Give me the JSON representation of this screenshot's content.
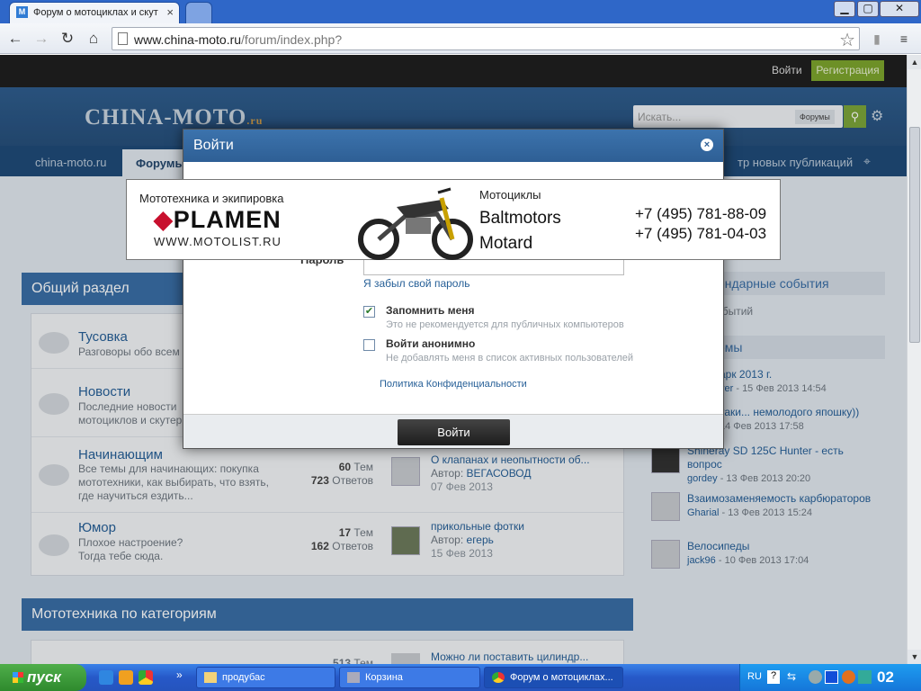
{
  "browser": {
    "tab_title": "Форум о мотоциклах и скут",
    "url_host": "www.china-moto.ru",
    "url_path": "/forum/index.php?",
    "win_min": "▁",
    "win_max": "▢",
    "win_close": "✕",
    "tab_close": "×"
  },
  "site": {
    "login": "Войти",
    "register": "Регистрация",
    "logo": "CHINA-MOTO",
    "logo_suffix": ".ru",
    "search_placeholder": "Искать...",
    "search_scope": "Форумы",
    "nav": {
      "home": "china-moto.ru",
      "forums": "Форумы",
      "new_posts": "тр новых публикаций"
    }
  },
  "forums": {
    "section_title": "Общий раздел",
    "rows": [
      {
        "title": "Тусовка",
        "desc": "Разговоры обо всем"
      },
      {
        "title": "Новости",
        "desc": "Последние новости\nмотоциклов и скутер"
      },
      {
        "title": "Начинающим",
        "desc": "Все темы для начинающих: покупка мототехники, как выбирать, что взять, где научиться ездить...",
        "threads": "60",
        "threads_label": "Тем",
        "posts": "723",
        "posts_label": "Ответов",
        "last_title": "О клапанах и неопытности об...",
        "last_by_label": "Автор:",
        "last_by": "ВЕГАСОВОД",
        "last_date": "07 Фев 2013"
      },
      {
        "title": "Юмор",
        "desc": "Плохое настроение?\nТогда тебе сюда.",
        "threads": "17",
        "threads_label": "Тем",
        "posts": "162",
        "posts_label": "Ответов",
        "last_title": "прикольные фотки",
        "last_by_label": "Автор:",
        "last_by": "егерь",
        "last_date": "15 Фев 2013"
      }
    ],
    "section2_title": "Мототехника по категориям",
    "next_row": {
      "threads": "513",
      "threads_label": "Тем",
      "last_title": "Можно ли поставить цилиндр..."
    }
  },
  "sidebar": {
    "calendar_title": "ендарные события",
    "calendar_text": "щих событий",
    "topics_title": "емы",
    "topics": [
      {
        "title": "арк 2013 г.",
        "user": "ver",
        "date": "- 15 Фев 2013 14:54"
      },
      {
        "title": "таки... немолодого япошку))",
        "user": "",
        "date": "14 Фев 2013 17:58"
      },
      {
        "title": "Shineray SD 125C Hunter - есть вопрос",
        "user": "gordey",
        "date": "- 13 Фев 2013 20:20"
      },
      {
        "title": "Взаимозаменяемость карбюраторов",
        "user": "Gharial",
        "date": "- 13 Фев 2013 15:24"
      },
      {
        "title": "Велосипеды",
        "user": "jack96",
        "date": "- 10 Фев 2013 17:04"
      }
    ]
  },
  "modal": {
    "title": "Войти",
    "close": "×",
    "password_label": "Пароль",
    "forgot": "Я забыл свой пароль",
    "remember_label": "Запомнить меня",
    "remember_hint": "Это не рекомендуется для публичных компьютеров",
    "remember_checked": true,
    "anon_label": "Войти анонимно",
    "anon_hint": "Не добавлять меня в список активных пользователей",
    "anon_checked": false,
    "policy": "Политика Конфиденциальности",
    "submit": "Войти"
  },
  "ad": {
    "tagline": "Мототехника и экипировка",
    "brand": "PLAMEN",
    "site": "WWW.MOTOLIST.RU",
    "category": "Мотоциклы",
    "brand2": "Baltmotors",
    "brand3": "Motard",
    "phone1": "+7 (495) 781-88-09",
    "phone2": "+7 (495) 781-04-03"
  },
  "taskbar": {
    "start": "пуск",
    "tasks": [
      "продубас",
      "Корзина",
      "Форум о мотоциклах..."
    ],
    "lang": "RU",
    "clock": "02"
  },
  "colors": {
    "accent": "#3a6ea5",
    "nav": "#1f4b78",
    "register": "#7da42d",
    "link": "#265f97"
  }
}
